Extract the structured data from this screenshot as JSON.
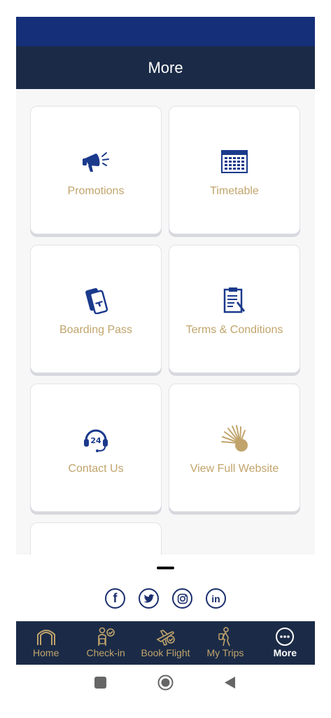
{
  "header": {
    "title": "More"
  },
  "cards": [
    {
      "label": "Promotions",
      "icon": "megaphone-icon"
    },
    {
      "label": "Timetable",
      "icon": "calendar-icon"
    },
    {
      "label": "Boarding Pass",
      "icon": "boarding-pass-icon"
    },
    {
      "label": "Terms & Conditions",
      "icon": "clipboard-icon"
    },
    {
      "label": "Contact Us",
      "icon": "headset-24-icon"
    },
    {
      "label": "View Full Website",
      "icon": "sunburst-logo-icon"
    }
  ],
  "social": [
    {
      "icon": "facebook-icon",
      "glyph": "f"
    },
    {
      "icon": "twitter-icon",
      "glyph": ""
    },
    {
      "icon": "instagram-icon",
      "glyph": ""
    },
    {
      "icon": "linkedin-icon",
      "glyph": "in"
    }
  ],
  "tabs": [
    {
      "label": "Home",
      "icon": "home-arch-icon",
      "active": false
    },
    {
      "label": "Check-in",
      "icon": "check-in-icon",
      "active": false
    },
    {
      "label": "Book Flight",
      "icon": "book-flight-icon",
      "active": false
    },
    {
      "label": "My Trips",
      "icon": "traveler-icon",
      "active": false
    },
    {
      "label": "More",
      "icon": "more-dots-icon",
      "active": true
    }
  ],
  "colors": {
    "navy": "#1b2b47",
    "blue_strip": "#152f79",
    "gold": "#c1a46b",
    "icon_blue": "#1b3a8c"
  }
}
